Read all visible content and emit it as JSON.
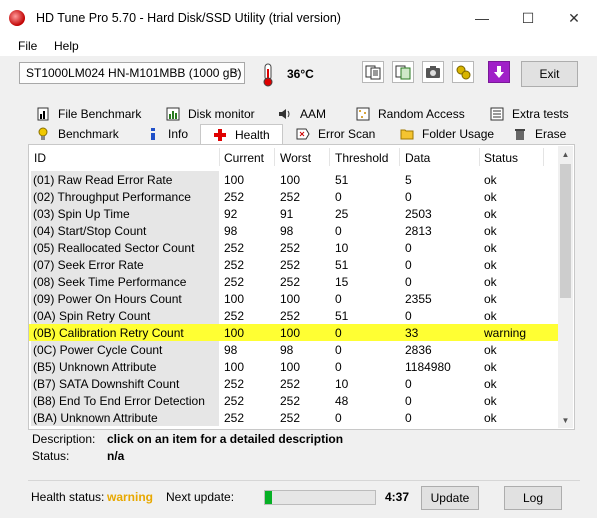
{
  "window": {
    "title": "HD Tune Pro 5.70 - Hard Disk/SSD Utility (trial version)",
    "controls": [
      "—",
      "☐",
      "✕"
    ]
  },
  "menu": [
    "File",
    "Help"
  ],
  "toolbar": {
    "drive": "ST1000LM024 HN-M101MBB (1000 gB)",
    "temperature": "36°C",
    "exit_label": "Exit"
  },
  "tabs_top": [
    "File Benchmark",
    "Disk monitor",
    "AAM",
    "Random Access",
    "Extra tests"
  ],
  "tabs_bottom": [
    "Benchmark",
    "Info",
    "Health",
    "Error Scan",
    "Folder Usage",
    "Erase"
  ],
  "table": {
    "headers": [
      "ID",
      "Current",
      "Worst",
      "Threshold",
      "Data",
      "Status"
    ],
    "rows": [
      [
        "(01) Raw Read Error Rate",
        "100",
        "100",
        "51",
        "5",
        "ok"
      ],
      [
        "(02) Throughput Performance",
        "252",
        "252",
        "0",
        "0",
        "ok"
      ],
      [
        "(03) Spin Up Time",
        "92",
        "91",
        "25",
        "2503",
        "ok"
      ],
      [
        "(04) Start/Stop Count",
        "98",
        "98",
        "0",
        "2813",
        "ok"
      ],
      [
        "(05) Reallocated Sector Count",
        "252",
        "252",
        "10",
        "0",
        "ok"
      ],
      [
        "(07) Seek Error Rate",
        "252",
        "252",
        "51",
        "0",
        "ok"
      ],
      [
        "(08) Seek Time Performance",
        "252",
        "252",
        "15",
        "0",
        "ok"
      ],
      [
        "(09) Power On Hours Count",
        "100",
        "100",
        "0",
        "2355",
        "ok"
      ],
      [
        "(0A) Spin Retry Count",
        "252",
        "252",
        "51",
        "0",
        "ok"
      ],
      [
        "(0B) Calibration Retry Count",
        "100",
        "100",
        "0",
        "33",
        "warning"
      ],
      [
        "(0C) Power Cycle Count",
        "98",
        "98",
        "0",
        "2836",
        "ok"
      ],
      [
        "(B5) Unknown Attribute",
        "100",
        "100",
        "0",
        "1184980",
        "ok"
      ],
      [
        "(B7) SATA Downshift Count",
        "252",
        "252",
        "10",
        "0",
        "ok"
      ],
      [
        "(B8) End To End Error Detection",
        "252",
        "252",
        "48",
        "0",
        "ok"
      ],
      [
        "(BA) Unknown Attribute",
        "252",
        "252",
        "0",
        "0",
        "ok"
      ]
    ],
    "warning_row_index": 9
  },
  "description": {
    "label": "Description:",
    "value": "click on an item for a detailed description",
    "status_label": "Status:",
    "status_value": "n/a"
  },
  "footer": {
    "health_label": "Health status:",
    "health_value": "warning",
    "next_update_label": "Next update:",
    "next_update_value": "4:37",
    "progress_fraction": 0.06,
    "update_label": "Update",
    "log_label": "Log"
  },
  "colors": {
    "warning_highlight": "#ffff33",
    "warning_text": "#e8a800",
    "progress_green": "#06b025"
  }
}
